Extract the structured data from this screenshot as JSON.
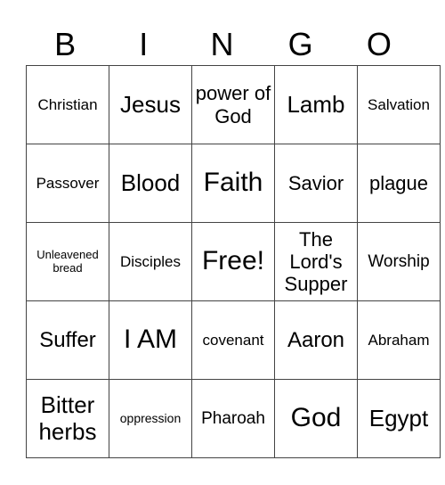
{
  "header": {
    "letters": [
      "B",
      "I",
      "N",
      "G",
      "O"
    ]
  },
  "grid": {
    "rows": [
      [
        "Christian",
        "Jesus",
        "power of God",
        "Lamb",
        "Salvation"
      ],
      [
        "Passover",
        "Blood",
        "Faith",
        "Savior",
        "plague"
      ],
      [
        "Unleavened bread",
        "Disciples",
        "Free!",
        "The Lord's Supper",
        "Worship"
      ],
      [
        "Suffer",
        "I AM",
        "covenant",
        "Aaron",
        "Abraham"
      ],
      [
        "Bitter herbs",
        "oppression",
        "Pharoah",
        "God",
        "Egypt"
      ]
    ]
  }
}
